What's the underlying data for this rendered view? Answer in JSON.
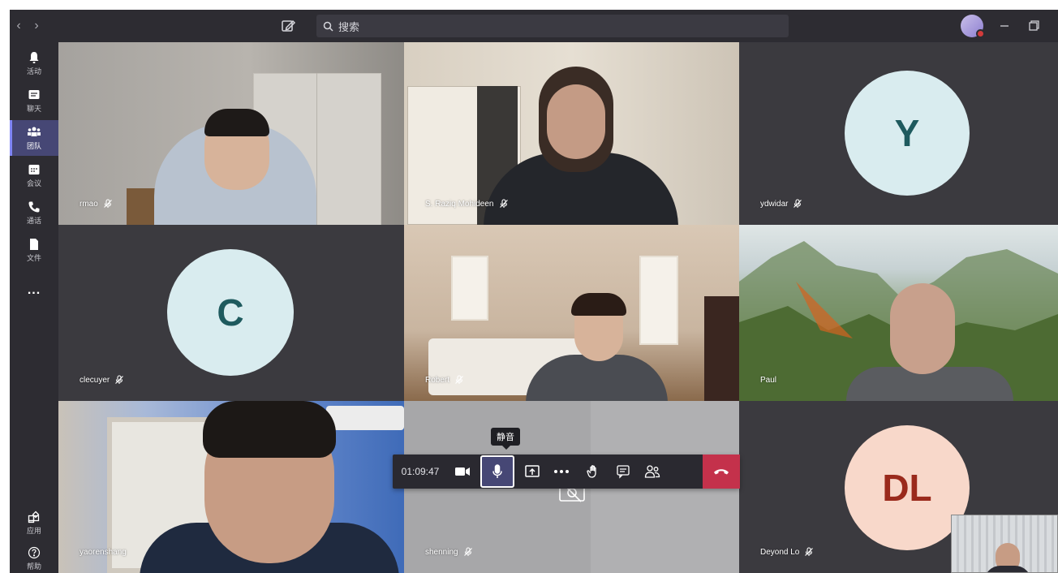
{
  "topbar": {
    "search_placeholder": "搜索"
  },
  "rail": {
    "items": [
      {
        "label": "活动",
        "icon": "bell-icon"
      },
      {
        "label": "聊天",
        "icon": "chat-icon"
      },
      {
        "label": "团队",
        "icon": "teams-icon",
        "active": true
      },
      {
        "label": "会议",
        "icon": "calendar-icon"
      },
      {
        "label": "通话",
        "icon": "phone-icon"
      },
      {
        "label": "文件",
        "icon": "file-icon"
      },
      {
        "label": "...",
        "icon": "more-icon"
      }
    ],
    "bottom": [
      {
        "label": "应用",
        "icon": "apps-icon"
      },
      {
        "label": "帮助",
        "icon": "help-icon"
      }
    ]
  },
  "participants": [
    {
      "name": "rmao"
    },
    {
      "name": "S. Raziq Mohideen"
    },
    {
      "name": "ydwidar",
      "initials": "Y"
    },
    {
      "name": "clecuyer",
      "initials": "C"
    },
    {
      "name": "Robert"
    },
    {
      "name": "Paul"
    },
    {
      "name": "yaorenshang"
    },
    {
      "name": "shenning"
    },
    {
      "name": "Deyond Lo",
      "initials": "DL"
    }
  ],
  "call": {
    "timer": "01:09:47",
    "mute_tooltip": "静音"
  },
  "colors": {
    "titlebar": "#2d2c32",
    "rail_active": "#464775",
    "hangup": "#c4314b",
    "initials_bg_light": "#d9ecef",
    "initials_bg_peach": "#f8d8ca",
    "initials_text_teal": "#1e5a5e",
    "initials_text_red": "#9a2a1c"
  }
}
